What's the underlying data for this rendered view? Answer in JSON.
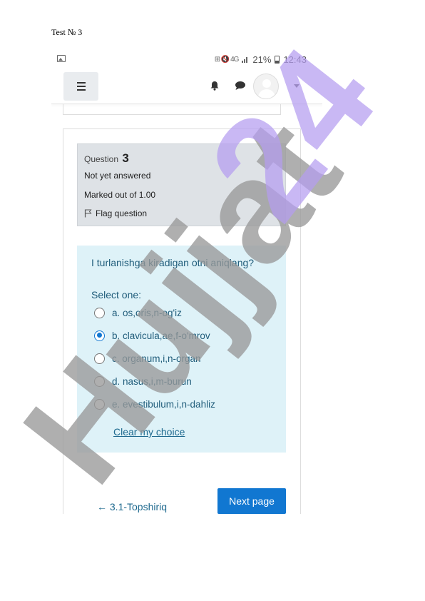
{
  "document": {
    "title": "Test № 3"
  },
  "status_bar": {
    "icons": "⊞ 🔇 4G",
    "battery": "21%",
    "time": "12:43"
  },
  "navbar": {
    "menu_icon": "hamburger-menu-icon",
    "notifications_icon": "bell-icon",
    "messages_icon": "chat-bubble-icon",
    "avatar_icon": "user-avatar-icon",
    "dropdown_icon": "caret-down-icon"
  },
  "question_info": {
    "question_label": "Question",
    "question_number": "3",
    "status": "Not yet answered",
    "marked_out": "Marked out of 1.00",
    "flag_label": "Flag question"
  },
  "question": {
    "text": "I turlanishga kiradigan otni aniqlang?",
    "select_label": "Select one:",
    "selected_index": 1,
    "options": [
      {
        "label": "a. os,oris,n-og'iz"
      },
      {
        "label": "b. clavicula,ae,f-o'mrov"
      },
      {
        "label": "c. organum,i,n-organ"
      },
      {
        "label": "d. nasus,i,m-burun"
      },
      {
        "label": "e. evestibulum,i,n-dahliz"
      }
    ],
    "clear_label": "Clear my choice"
  },
  "navigation": {
    "prev_label": "← 3.1-Topshiriq",
    "next_label": "Next page"
  },
  "watermark": {
    "text": "Hujjat24"
  },
  "colors": {
    "accent": "#1177d1",
    "content_bg": "#def2f8",
    "info_bg": "#dee2e6",
    "text_teal": "#1f5c7a",
    "watermark_gray": "#999999",
    "watermark_purple": "#b49cf0"
  }
}
